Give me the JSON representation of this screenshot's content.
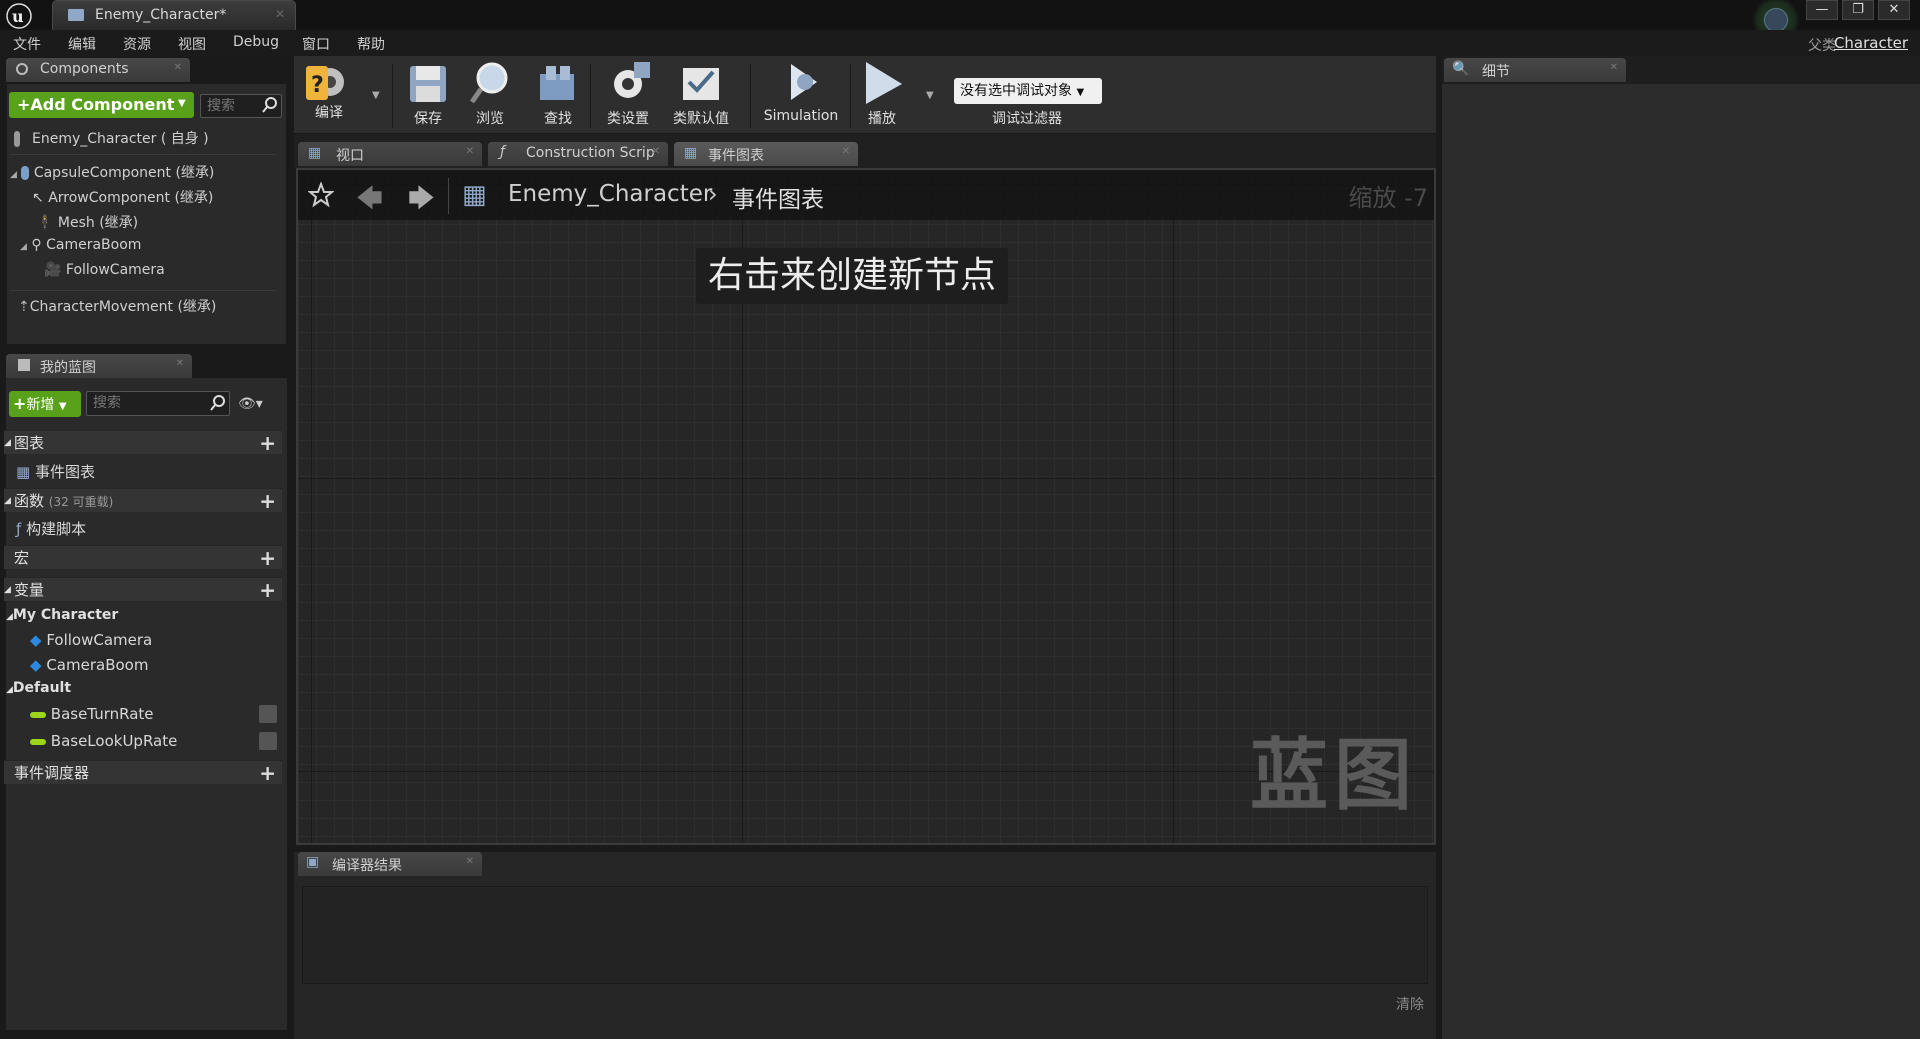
{
  "window": {
    "doc_tab": "Enemy_Character*",
    "parent_label": "父类",
    "parent_link": "Character"
  },
  "menu": [
    "文件",
    "编辑",
    "资源",
    "视图",
    "Debug",
    "窗口",
    "帮助"
  ],
  "components": {
    "tab": "Components",
    "add_button": "+Add Component",
    "search_placeholder": "搜索",
    "self_row": "Enemy_Character ( 自身 )",
    "tree": [
      {
        "label": "CapsuleComponent (继承)",
        "icon": "capsule-icon"
      },
      {
        "label": "ArrowComponent (继承)",
        "icon": "arrow-icon"
      },
      {
        "label": "Mesh (继承)",
        "icon": "mesh-icon"
      },
      {
        "label": "CameraBoom",
        "icon": "spring-arm-icon"
      },
      {
        "label": "FollowCamera",
        "icon": "camera-icon"
      },
      {
        "label": "CharacterMovement (继承)",
        "icon": "movement-icon"
      }
    ]
  },
  "my_blueprint": {
    "tab": "我的蓝图",
    "new_button": "新增",
    "search_placeholder": "搜索",
    "sections": {
      "graphs": "图表",
      "graphs_item": "事件图表",
      "functions": "函数",
      "functions_count": "(32 可重载)",
      "functions_item": "构建脚本",
      "macros": "宏",
      "variables": "变量",
      "dispatchers": "事件调度器"
    },
    "var_groups": [
      {
        "name": "My Character",
        "items": [
          "FollowCamera",
          "CameraBoom"
        ]
      },
      {
        "name": "Default",
        "items": [
          "BaseTurnRate",
          "BaseLookUpRate"
        ]
      }
    ]
  },
  "toolbar": {
    "compile": "编译",
    "save": "保存",
    "browse": "浏览",
    "find": "查找",
    "class_settings": "类设置",
    "class_defaults": "类默认值",
    "simulation": "Simulation",
    "play": "播放",
    "debug_select": "没有选中调试对象",
    "debug_filter": "调试过滤器"
  },
  "center_tabs": [
    "视口",
    "Construction Scrip",
    "事件图表"
  ],
  "graph": {
    "breadcrumb_root": "Enemy_Character",
    "breadcrumb_current": "事件图表",
    "zoom": "缩放 -7",
    "hint": "右击来创建新节点",
    "watermark": "蓝图"
  },
  "compiler": {
    "tab": "编译器结果",
    "clear": "清除"
  },
  "details": {
    "tab": "细节"
  },
  "colors": {
    "accent_green": "#5aa11b",
    "float_var": "#9cd61b",
    "object_var": "#2b8ae0"
  }
}
